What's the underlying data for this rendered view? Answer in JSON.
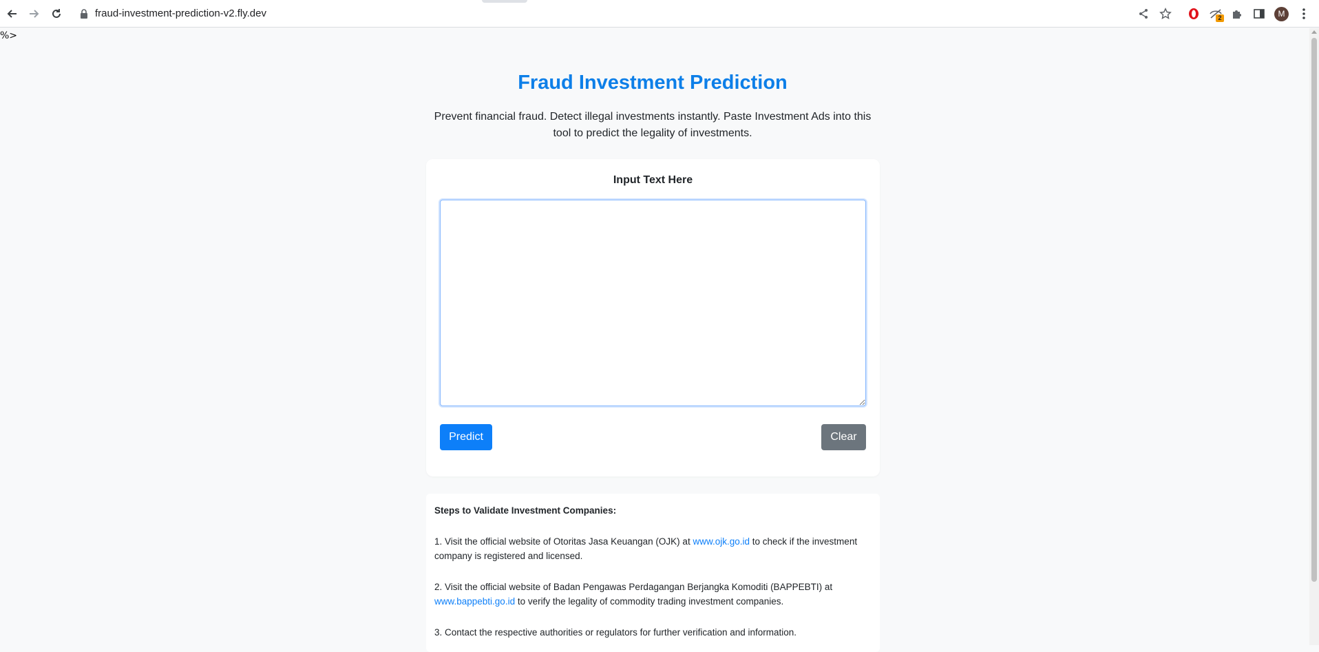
{
  "browser": {
    "url": "fraud-investment-prediction-v2.fly.dev",
    "extension_badge": "2",
    "avatar_initial": "M",
    "icons": {
      "back": "back-arrow-icon",
      "forward": "forward-arrow-icon",
      "reload": "reload-icon",
      "lock": "lock-icon",
      "share": "share-icon",
      "bookmark": "star-icon",
      "opera": "opera-icon",
      "extension_vpn": "eye-off-icon",
      "extensions": "puzzle-icon",
      "side_panel": "side-panel-icon",
      "menu": "kebab-menu-icon"
    }
  },
  "page": {
    "stray_text": "%>",
    "title": "Fraud Investment Prediction",
    "subtitle": "Prevent financial fraud. Detect illegal investments instantly. Paste Investment Ads into this tool to predict the legality of investments.",
    "form": {
      "label": "Input Text Here",
      "textarea_value": "",
      "predict_label": "Predict",
      "clear_label": "Clear"
    },
    "steps": {
      "heading": "Steps to Validate Investment Companies:",
      "step1_prefix": "1. Visit the official website of Otoritas Jasa Keuangan (OJK) at ",
      "step1_link": "www.ojk.go.id",
      "step1_suffix": " to check if the investment company is registered and licensed.",
      "step2_prefix": "2. Visit the official website of Badan Pengawas Perdagangan Berjangka Komoditi (BAPPEBTI) at ",
      "step2_link": "www.bappebti.go.id",
      "step2_suffix": " to verify the legality of commodity trading investment companies.",
      "step3": "3. Contact the respective authorities or regulators for further verification and information."
    },
    "colors": {
      "accent": "#0d7ff9",
      "title": "#0d7fe8",
      "clear_button": "#6c757d",
      "background": "#f8f9fa"
    }
  }
}
